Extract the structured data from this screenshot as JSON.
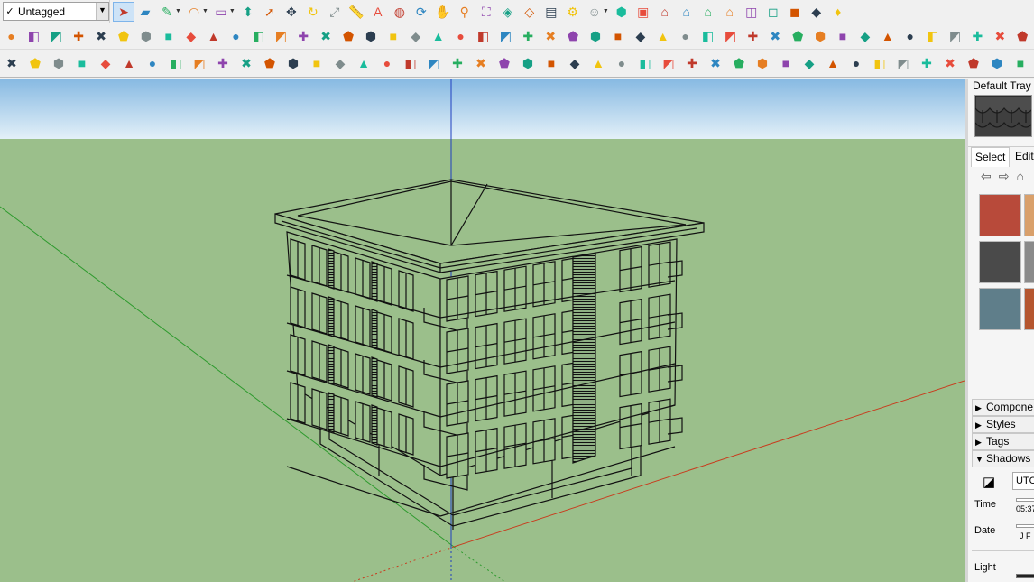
{
  "toolbar": {
    "tag_value": "Untagged",
    "tag_check": "✓",
    "row1_icons": [
      "select-icon",
      "eraser-icon",
      "pencil-line-icon",
      "arc-icon",
      "rectangle-icon",
      "push-pull-icon",
      "follow-me-icon",
      "move-icon",
      "rotate-icon",
      "scale-icon",
      "tape-measure-icon",
      "text-label-icon",
      "paint-bucket-icon",
      "orbit-icon",
      "pan-icon",
      "zoom-icon",
      "zoom-extents-icon",
      "3d-warehouse-icon",
      "extension-warehouse-icon",
      "layout-icon",
      "extension-manager-icon",
      "account-icon",
      "iso-view-icon",
      "top-view-icon",
      "front-view-icon",
      "right-view-icon",
      "back-view-icon",
      "left-view-icon",
      "xray-icon",
      "wireframe-icon",
      "hidden-line-icon",
      "shaded-texture-icon",
      "ruby-icon"
    ],
    "row2_count": 46,
    "row3_count": 44
  },
  "tray": {
    "title": "Default Tray",
    "tabs": {
      "select": "Select",
      "edit": "Edit"
    },
    "swatch_colors": [
      "#b84a3a",
      "#d9a06b",
      "#4a4a4a",
      "#8a8a8a",
      "#5f7e8a",
      "#b5562f"
    ],
    "panels": [
      {
        "label": "Compone",
        "expanded": false
      },
      {
        "label": "Styles",
        "expanded": false
      },
      {
        "label": "Tags",
        "expanded": false
      },
      {
        "label": "Shadows",
        "expanded": true
      }
    ],
    "shadows": {
      "utc": "UTC-",
      "time_label": "Time",
      "time_value": "05:37",
      "date_label": "Date",
      "date_months": "J F",
      "light_label": "Light"
    }
  },
  "colors": {
    "sky_top": "#7fb6e3",
    "sky_bottom": "#dcecf6",
    "ground": "#9bbf8b",
    "edges": "#111111",
    "axis_red": "#c83c1e",
    "axis_green": "#2d9a2d",
    "axis_blue": "#1f3fbf"
  }
}
